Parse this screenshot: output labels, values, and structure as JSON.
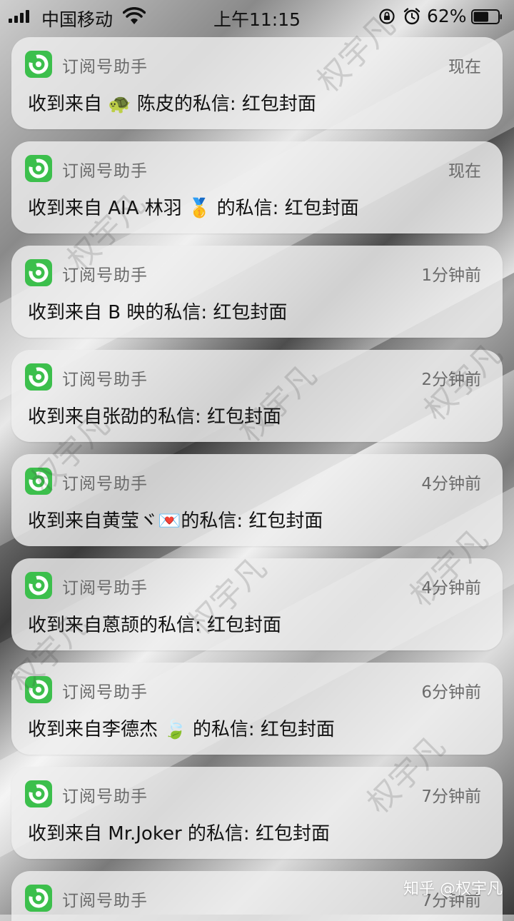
{
  "status_bar": {
    "carrier": "中国移动",
    "time": "上午11:15",
    "battery_percent": "62%",
    "signal_icon": "cellular-signal-icon",
    "wifi_icon": "wifi-icon",
    "rotation_lock_icon": "rotation-lock-icon",
    "alarm_icon": "alarm-icon",
    "battery_icon": "battery-icon",
    "battery_level": 0.62
  },
  "notifications": [
    {
      "app": "订阅号助手",
      "time": "现在",
      "message": "收到来自 🐢 陈皮的私信: 红包封面"
    },
    {
      "app": "订阅号助手",
      "time": "现在",
      "message": "收到来自 AIA 林羽 🥇 的私信: 红包封面"
    },
    {
      "app": "订阅号助手",
      "time": "1分钟前",
      "message": "收到来自 B 映的私信: 红包封面"
    },
    {
      "app": "订阅号助手",
      "time": "2分钟前",
      "message": "收到来自张劭的私信: 红包封面"
    },
    {
      "app": "订阅号助手",
      "time": "4分钟前",
      "message": "收到来自黄莹ヾ💌的私信: 红包封面"
    },
    {
      "app": "订阅号助手",
      "time": "4分钟前",
      "message": "收到来自蒽颉的私信: 红包封面"
    },
    {
      "app": "订阅号助手",
      "time": "6分钟前",
      "message": "收到来自李德杰 🍃 的私信: 红包封面"
    },
    {
      "app": "订阅号助手",
      "time": "7分钟前",
      "message": "收到来自 Mr.Joker 的私信: 红包封面"
    },
    {
      "app": "订阅号助手",
      "time": "7分钟前",
      "message": ""
    }
  ],
  "app_icon": "subscription-assistant-icon",
  "watermarks": [
    "权宇凡",
    "权宇凡",
    "权宇凡",
    "权宇凡",
    "权宇凡",
    "权宇凡",
    "权宇凡",
    "权宇凡",
    "权宇凡"
  ],
  "footer_watermark": "知乎 @权宇凡",
  "colors": {
    "app_icon_bg": "#3cbf4c",
    "card_bg": "rgba(238,238,238,0.82)"
  }
}
